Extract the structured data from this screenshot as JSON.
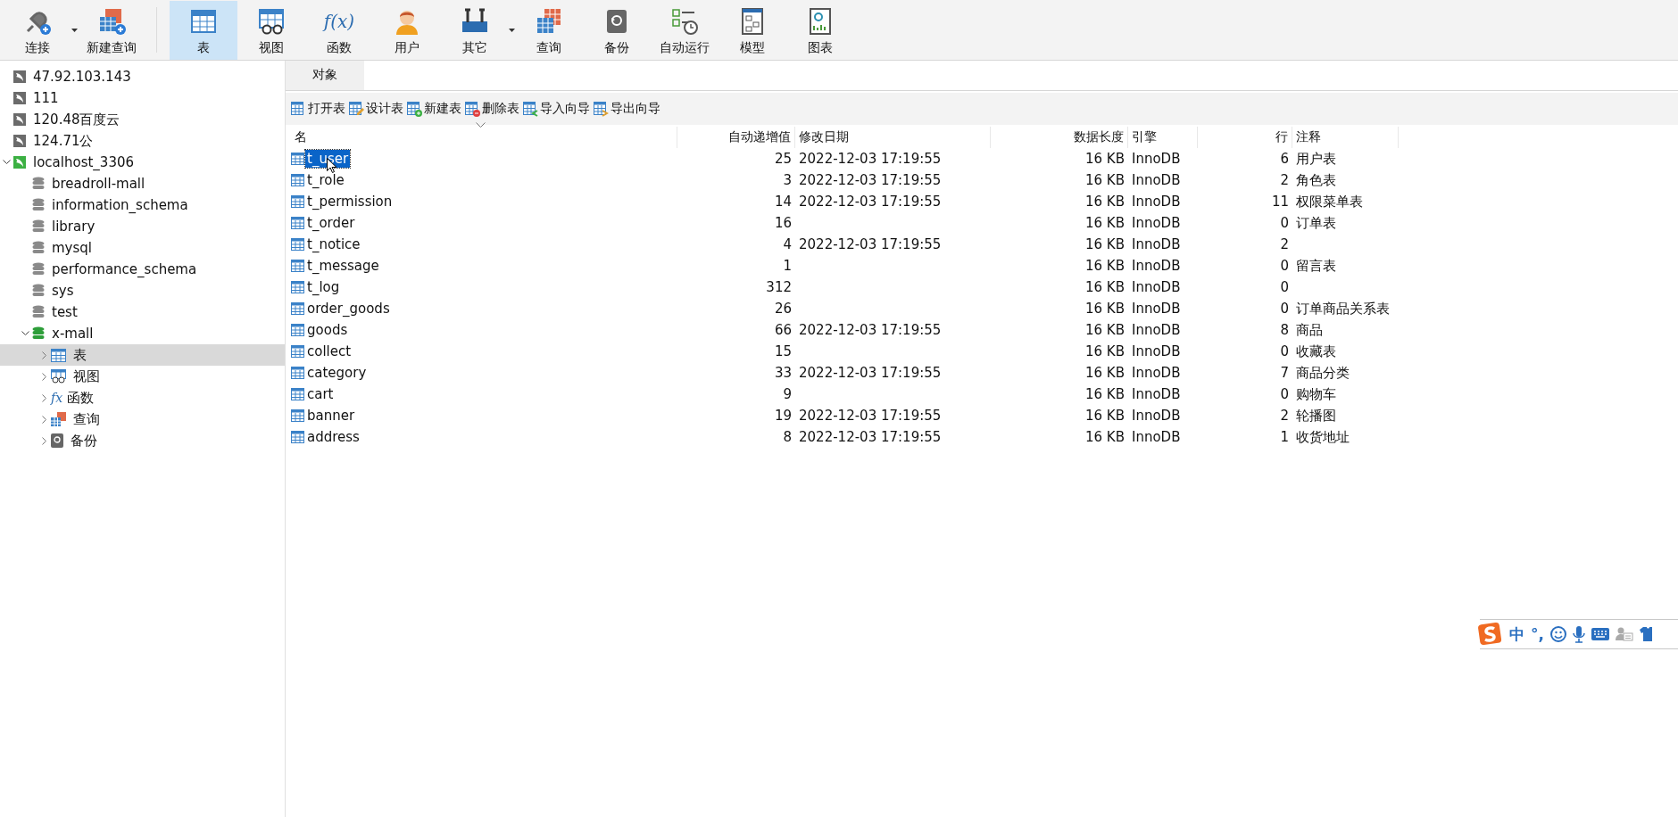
{
  "toolbar": [
    {
      "label": "连接",
      "kind": "connect",
      "selected": false,
      "dropdown": true
    },
    {
      "label": "新建查询",
      "kind": "new-query",
      "selected": false,
      "dropdown": false
    },
    {
      "label": "表",
      "kind": "table",
      "selected": true,
      "dropdown": false
    },
    {
      "label": "视图",
      "kind": "view",
      "selected": false,
      "dropdown": false
    },
    {
      "label": "函数",
      "kind": "function",
      "glyph": "f(x)",
      "selected": false,
      "dropdown": false
    },
    {
      "label": "用户",
      "kind": "user",
      "selected": false,
      "dropdown": false
    },
    {
      "label": "其它",
      "kind": "tools",
      "selected": false,
      "dropdown": true
    },
    {
      "label": "查询",
      "kind": "query",
      "selected": false,
      "dropdown": false
    },
    {
      "label": "备份",
      "kind": "backup",
      "selected": false,
      "dropdown": false
    },
    {
      "label": "自动运行",
      "kind": "schedule",
      "selected": false,
      "dropdown": false
    },
    {
      "label": "模型",
      "kind": "model",
      "selected": false,
      "dropdown": false
    },
    {
      "label": "图表",
      "kind": "chart",
      "selected": false,
      "dropdown": false
    }
  ],
  "sidebar": {
    "items": [
      {
        "label": "47.92.103.143",
        "kind": "connection",
        "expanded": false,
        "selected": false
      },
      {
        "label": "111",
        "kind": "connection",
        "expanded": false,
        "selected": false
      },
      {
        "label": "120.48百度云",
        "kind": "connection",
        "expanded": false,
        "selected": false
      },
      {
        "label": "124.71公",
        "kind": "connection",
        "expanded": false,
        "selected": false
      },
      {
        "label": "localhost_3306",
        "kind": "connection",
        "expanded": true,
        "selected": false,
        "children": [
          {
            "label": "breadroll-mall",
            "kind": "database",
            "expanded": false,
            "selected": false
          },
          {
            "label": "information_schema",
            "kind": "database",
            "expanded": false,
            "selected": false
          },
          {
            "label": "library",
            "kind": "database",
            "expanded": false,
            "selected": false
          },
          {
            "label": "mysql",
            "kind": "database",
            "expanded": false,
            "selected": false
          },
          {
            "label": "performance_schema",
            "kind": "database",
            "expanded": false,
            "selected": false
          },
          {
            "label": "sys",
            "kind": "database",
            "expanded": false,
            "selected": false
          },
          {
            "label": "test",
            "kind": "database",
            "expanded": false,
            "selected": false
          },
          {
            "label": "x-mall",
            "kind": "database",
            "expanded": true,
            "selected": false,
            "children": [
              {
                "label": "表",
                "kind": "tables",
                "expanded": false,
                "selected": true
              },
              {
                "label": "视图",
                "kind": "views",
                "expanded": false,
                "selected": false
              },
              {
                "label": "函数",
                "kind": "functions",
                "glyph": "fx",
                "expanded": false,
                "selected": false
              },
              {
                "label": "查询",
                "kind": "queries",
                "expanded": false,
                "selected": false
              },
              {
                "label": "备份",
                "kind": "backups",
                "expanded": false,
                "selected": false
              }
            ]
          }
        ]
      }
    ]
  },
  "tabs": [
    {
      "label": "对象",
      "selected": true
    }
  ],
  "actions": [
    {
      "label": "打开表",
      "kind": "open"
    },
    {
      "label": "设计表",
      "kind": "design"
    },
    {
      "label": "新建表",
      "kind": "new"
    },
    {
      "label": "删除表",
      "kind": "delete"
    },
    {
      "label": "导入向导",
      "kind": "import"
    },
    {
      "label": "导出向导",
      "kind": "export"
    }
  ],
  "table": {
    "columns": [
      {
        "label": "名",
        "kind": "text"
      },
      {
        "label": "自动递增值",
        "kind": "number"
      },
      {
        "label": "修改日期",
        "kind": "text"
      },
      {
        "label": "数据长度",
        "kind": "number"
      },
      {
        "label": "引擎",
        "kind": "text"
      },
      {
        "label": "行",
        "kind": "number"
      },
      {
        "label": "注释",
        "kind": "text"
      }
    ],
    "rows": [
      {
        "selected": true,
        "cells": [
          "t_user",
          "25",
          "2022-12-03 17:19:55",
          "16 KB",
          "InnoDB",
          "6",
          "用户表"
        ]
      },
      {
        "selected": false,
        "cells": [
          "t_role",
          "3",
          "2022-12-03 17:19:55",
          "16 KB",
          "InnoDB",
          "2",
          "角色表"
        ]
      },
      {
        "selected": false,
        "cells": [
          "t_permission",
          "14",
          "2022-12-03 17:19:55",
          "16 KB",
          "InnoDB",
          "11",
          "权限菜单表"
        ]
      },
      {
        "selected": false,
        "cells": [
          "t_order",
          "16",
          "",
          "16 KB",
          "InnoDB",
          "0",
          "订单表"
        ]
      },
      {
        "selected": false,
        "cells": [
          "t_notice",
          "4",
          "2022-12-03 17:19:55",
          "16 KB",
          "InnoDB",
          "2",
          ""
        ]
      },
      {
        "selected": false,
        "cells": [
          "t_message",
          "1",
          "",
          "16 KB",
          "InnoDB",
          "0",
          "留言表"
        ]
      },
      {
        "selected": false,
        "cells": [
          "t_log",
          "312",
          "",
          "16 KB",
          "InnoDB",
          "0",
          ""
        ]
      },
      {
        "selected": false,
        "cells": [
          "order_goods",
          "26",
          "",
          "16 KB",
          "InnoDB",
          "0",
          "订单商品关系表"
        ]
      },
      {
        "selected": false,
        "cells": [
          "goods",
          "66",
          "2022-12-03 17:19:55",
          "16 KB",
          "InnoDB",
          "8",
          "商品"
        ]
      },
      {
        "selected": false,
        "cells": [
          "collect",
          "15",
          "",
          "16 KB",
          "InnoDB",
          "0",
          "收藏表"
        ]
      },
      {
        "selected": false,
        "cells": [
          "category",
          "33",
          "2022-12-03 17:19:55",
          "16 KB",
          "InnoDB",
          "7",
          "商品分类"
        ]
      },
      {
        "selected": false,
        "cells": [
          "cart",
          "9",
          "",
          "16 KB",
          "InnoDB",
          "0",
          "购物车"
        ]
      },
      {
        "selected": false,
        "cells": [
          "banner",
          "19",
          "2022-12-03 17:19:55",
          "16 KB",
          "InnoDB",
          "2",
          "轮播图"
        ]
      },
      {
        "selected": false,
        "cells": [
          "address",
          "8",
          "2022-12-03 17:19:55",
          "16 KB",
          "InnoDB",
          "1",
          "收货地址"
        ]
      }
    ]
  },
  "ime_bar": {
    "mode": "中",
    "punctuation": "°,"
  }
}
